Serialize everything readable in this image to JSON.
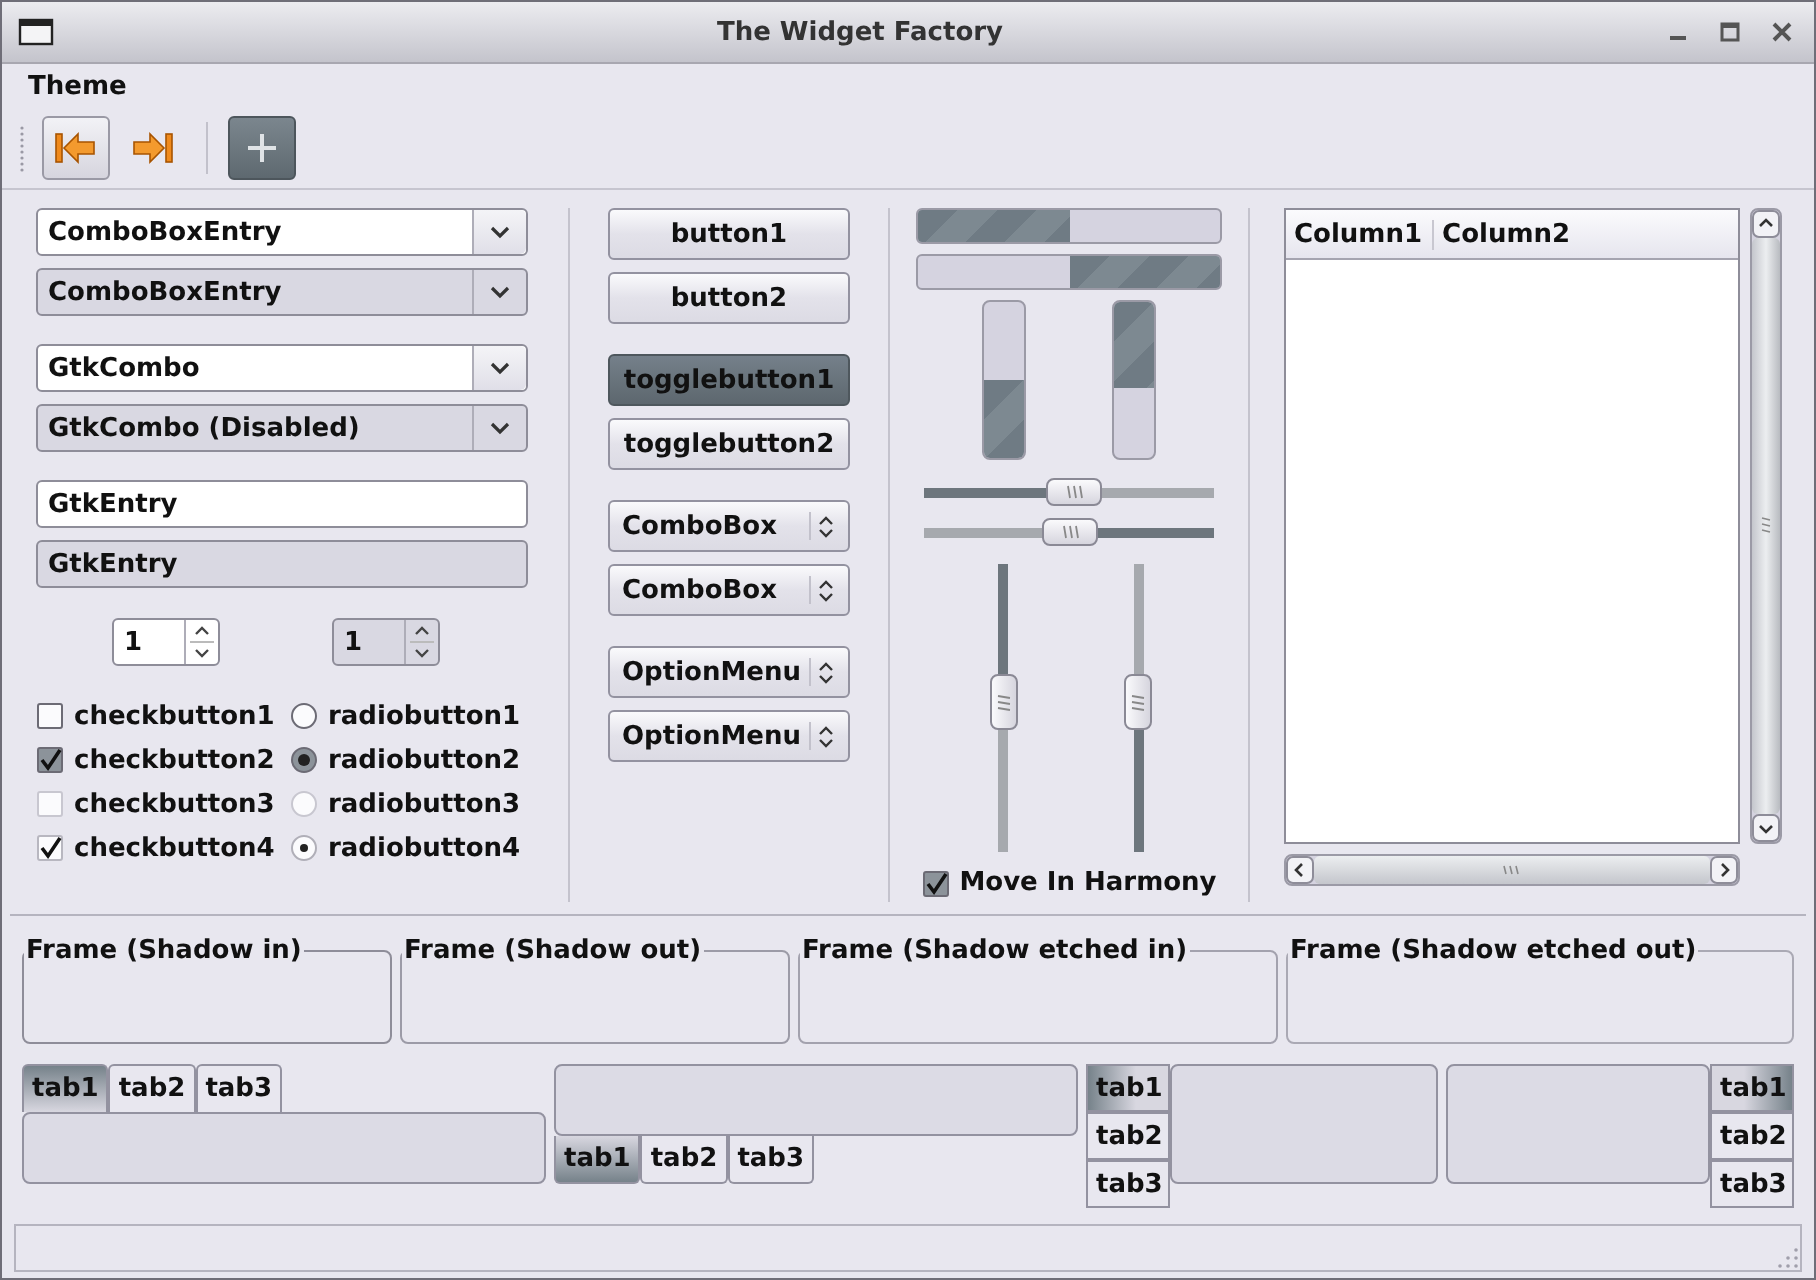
{
  "window": {
    "title": "The Widget Factory"
  },
  "menu": [
    {
      "label": "Theme"
    }
  ],
  "toolbar": [
    {
      "kind": "back",
      "raised": true,
      "pressed": false
    },
    {
      "kind": "forward",
      "raised": false,
      "pressed": false
    },
    {
      "kind": "separator"
    },
    {
      "kind": "add",
      "raised": false,
      "pressed": true
    }
  ],
  "field_groups": [
    {
      "fields": [
        {
          "kind": "combo-entry",
          "value": "ComboBoxEntry",
          "disabled": false
        },
        {
          "kind": "combo-entry",
          "value": "ComboBoxEntry",
          "disabled": true
        }
      ]
    },
    {
      "fields": [
        {
          "kind": "combo",
          "value": "GtkCombo",
          "disabled": false
        },
        {
          "kind": "combo",
          "value": "GtkCombo (Disabled)",
          "disabled": true
        }
      ]
    },
    {
      "fields": [
        {
          "kind": "entry",
          "value": "GtkEntry",
          "disabled": false
        },
        {
          "kind": "entry",
          "value": "GtkEntry",
          "disabled": true
        }
      ]
    }
  ],
  "spin_buttons": [
    {
      "value": "1",
      "disabled": false
    },
    {
      "value": "1",
      "disabled": true
    }
  ],
  "check_buttons": [
    {
      "label": "checkbutton1",
      "kind": "box",
      "checked": false,
      "disabled": false
    },
    {
      "label": "checkbutton2",
      "kind": "box",
      "checked": true,
      "disabled": false
    },
    {
      "label": "checkbutton3",
      "kind": "box",
      "checked": false,
      "disabled": true
    },
    {
      "label": "checkbutton4",
      "kind": "plain",
      "checked": true,
      "disabled": false
    }
  ],
  "radio_buttons": [
    {
      "label": "radiobutton1",
      "kind": "box",
      "selected": false,
      "disabled": false
    },
    {
      "label": "radiobutton2",
      "kind": "box",
      "selected": true,
      "disabled": false
    },
    {
      "label": "radiobutton3",
      "kind": "box",
      "selected": false,
      "disabled": true
    },
    {
      "label": "radiobutton4",
      "kind": "plain",
      "selected": true,
      "disabled": false
    }
  ],
  "buttons": [
    {
      "label": "button1"
    },
    {
      "label": "button2"
    }
  ],
  "toggle_buttons": [
    {
      "label": "togglebutton1",
      "on": true
    },
    {
      "label": "togglebutton2",
      "on": false
    }
  ],
  "combo_boxes": [
    {
      "label": "ComboBox"
    },
    {
      "label": "ComboBox"
    }
  ],
  "option_menus": [
    {
      "label": "OptionMenu"
    },
    {
      "label": "OptionMenu"
    }
  ],
  "h_progress": [
    {
      "level": 0.5,
      "inverted": false
    },
    {
      "level": 0.5,
      "inverted": true
    }
  ],
  "v_progress": [
    {
      "level": 0.5,
      "inverted": false
    },
    {
      "level": 0.55,
      "inverted": true
    }
  ],
  "h_scales": [
    {
      "level": 0.52,
      "inverted": false
    },
    {
      "level": 0.5,
      "inverted": true
    }
  ],
  "v_scales": [
    {
      "level": 0.47,
      "inverted": false
    },
    {
      "level": 0.47,
      "inverted": true
    }
  ],
  "harmony": {
    "label": "Move In Harmony",
    "checked": true
  },
  "tree": {
    "columns": [
      "Column1",
      "Column2"
    ]
  },
  "frames": [
    {
      "label": "Frame (Shadow in)",
      "kind": "in"
    },
    {
      "label": "Frame (Shadow out)",
      "kind": "out"
    },
    {
      "label": "Frame (Shadow etched in)",
      "kind": "etchedin"
    },
    {
      "label": "Frame (Shadow etched out)",
      "kind": "etchedout"
    }
  ],
  "notebooks": [
    {
      "kind": "top",
      "tabs": [
        {
          "label": "tab1",
          "selected": true
        },
        {
          "label": "tab2",
          "selected": false
        },
        {
          "label": "tab3",
          "selected": false
        }
      ]
    },
    {
      "kind": "bottom",
      "tabs": [
        {
          "label": "tab1",
          "selected": true
        },
        {
          "label": "tab2",
          "selected": false
        },
        {
          "label": "tab3",
          "selected": false
        }
      ]
    },
    {
      "kind": "left",
      "tabs": [
        {
          "label": "tab1",
          "selected": true
        },
        {
          "label": "tab2",
          "selected": false
        },
        {
          "label": "tab3",
          "selected": false
        }
      ]
    },
    {
      "kind": "right",
      "tabs": [
        {
          "label": "tab1",
          "selected": true
        },
        {
          "label": "tab2",
          "selected": false
        },
        {
          "label": "tab3",
          "selected": false
        }
      ]
    }
  ]
}
